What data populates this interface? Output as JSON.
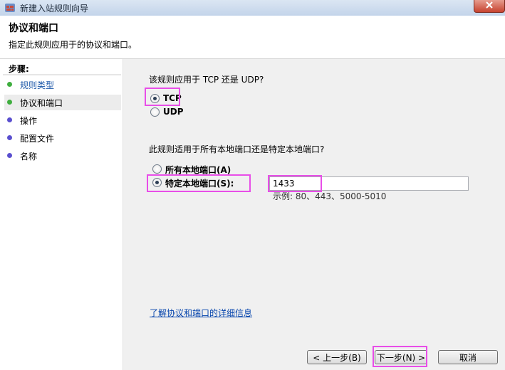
{
  "window": {
    "title": "新建入站规则向导"
  },
  "header": {
    "title": "协议和端口",
    "subtitle": "指定此规则应用于的协议和端口。"
  },
  "steps": {
    "title": "步骤:",
    "items": [
      {
        "label": "规则类型",
        "dot_color": "#3fae3f",
        "color": "#1a56a8"
      },
      {
        "label": "协议和端口",
        "dot_color": "#3fae3f",
        "color": "#000000"
      },
      {
        "label": "操作",
        "dot_color": "#5a4fcf",
        "color": "#000000"
      },
      {
        "label": "配置文件",
        "dot_color": "#5a4fcf",
        "color": "#000000"
      },
      {
        "label": "名称",
        "dot_color": "#5a4fcf",
        "color": "#000000"
      }
    ]
  },
  "main": {
    "protocol_question": "该规则应用于 TCP 还是 UDP?",
    "protocol_options": [
      {
        "label": "TCP",
        "checked": true
      },
      {
        "label": "UDP",
        "checked": false
      }
    ],
    "port_question": "此规则适用于所有本地端口还是特定本地端口?",
    "port_options": [
      {
        "label": "所有本地端口(A)",
        "checked": false
      },
      {
        "label": "特定本地端口(S):",
        "checked": true
      }
    ],
    "port_value": "1433",
    "port_hint": "示例: 80、443、5000-5010",
    "learn_link": "了解协议和端口的详细信息"
  },
  "buttons": {
    "back": "< 上一步(B)",
    "next": "下一步(N) >",
    "cancel": "取消"
  },
  "colors": {
    "highlight": "#e84ee8",
    "link": "#0645ad"
  }
}
